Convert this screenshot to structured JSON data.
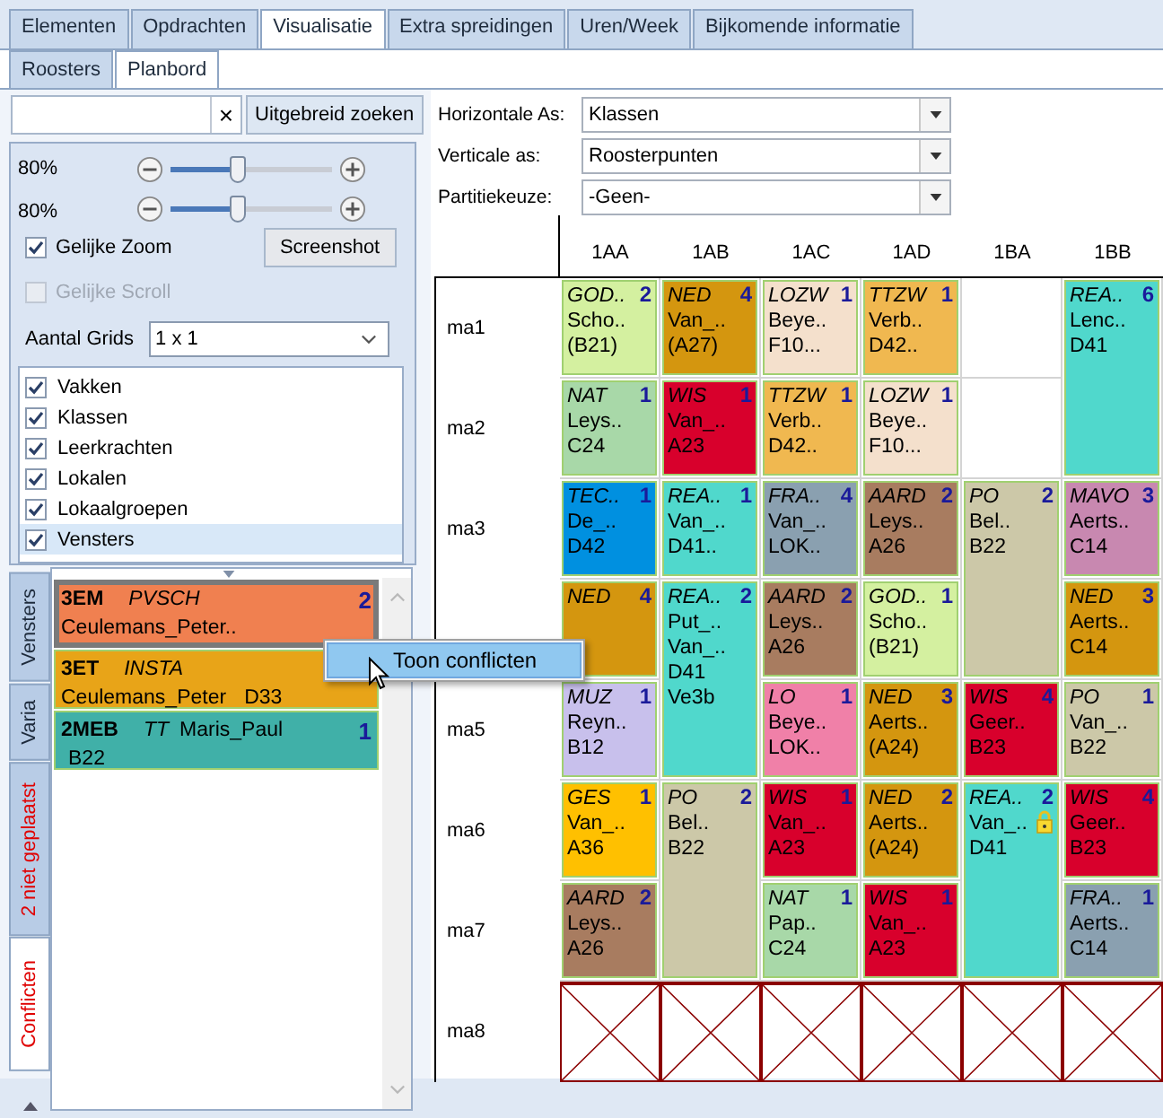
{
  "tabs": [
    {
      "label": "Elementen",
      "selected": false
    },
    {
      "label": "Opdrachten",
      "selected": false
    },
    {
      "label": "Visualisatie",
      "selected": true
    },
    {
      "label": "Extra spreidingen",
      "selected": false
    },
    {
      "label": "Uren/Week",
      "selected": false
    },
    {
      "label": "Bijkomende informatie",
      "selected": false
    }
  ],
  "subtabs": [
    {
      "label": "Roosters",
      "selected": false
    },
    {
      "label": "Planbord",
      "selected": true
    }
  ],
  "search": {
    "clear": "×",
    "button": "Uitgebreid zoeken"
  },
  "zoom": [
    {
      "reading": "80%",
      "level": 0.42
    },
    {
      "reading": "80%",
      "level": 0.42
    }
  ],
  "options": [
    {
      "label": "Gelijke Zoom",
      "checked": true,
      "disabled": false
    },
    {
      "label": "Gelijke Scroll",
      "checked": false,
      "disabled": true
    }
  ],
  "screenshot_button": "Screenshot",
  "grids": {
    "label": "Aantal Grids",
    "value": "1 x 1"
  },
  "layers": [
    {
      "label": "Vakken",
      "checked": true,
      "selected": false
    },
    {
      "label": "Klassen",
      "checked": true,
      "selected": false
    },
    {
      "label": "Leerkrachten",
      "checked": true,
      "selected": false
    },
    {
      "label": "Lokalen",
      "checked": true,
      "selected": false
    },
    {
      "label": "Lokaalgroepen",
      "checked": true,
      "selected": false
    },
    {
      "label": "Vensters",
      "checked": true,
      "selected": true
    }
  ],
  "side_tabs": [
    {
      "label": "Vensters",
      "selected": false,
      "alert": false
    },
    {
      "label": "Varia",
      "selected": false,
      "alert": false
    },
    {
      "label": "2 niet geplaatst",
      "selected": false,
      "alert": true
    },
    {
      "label": "Conflicten",
      "selected": true,
      "alert": true
    }
  ],
  "conflicts": [
    {
      "kind": "standard",
      "class": "3EM",
      "subject": "PVSCH",
      "count": "2",
      "teacher": "Ceulemans_Peter..",
      "color": "#f08050",
      "selected": true
    },
    {
      "kind": "standard",
      "class": "3ET",
      "subject": "INSTA",
      "teacher": "Ceulemans_Peter",
      "room": "D33",
      "color": "#e8a418",
      "selected": false
    },
    {
      "kind": "teacher_first",
      "class": "2MEB",
      "subject": "TT",
      "teacher": "Maris_Paul",
      "count": "1",
      "room": "B22",
      "color": "#40b0a8",
      "selected": false
    }
  ],
  "axes": [
    {
      "label": "Horizontale As:",
      "value": "Klassen"
    },
    {
      "label": "Verticale as:",
      "value": "Roosterpunten"
    },
    {
      "label": "Partitiekeuze:",
      "value": "-Geen-"
    }
  ],
  "grid": {
    "rows": [
      {
        "label": "ma1"
      },
      {
        "label": "ma2"
      },
      {
        "label": "ma3"
      },
      {},
      {
        "label": "ma5"
      },
      {
        "label": "ma6"
      },
      {
        "label": "ma7"
      },
      {
        "label": "ma8"
      }
    ],
    "columns": [
      {
        "label": "1AA",
        "slots": [
          {
            "kind": "lesson",
            "subject": "GOD..",
            "count": "2",
            "lines": [
              "Scho..",
              "(B21)"
            ],
            "color": "#d4f0a0",
            "double": false,
            "locked": false
          },
          {
            "kind": "lesson",
            "subject": "NAT",
            "count": "1",
            "lines": [
              "Leys..",
              "C24"
            ],
            "color": "#a8d8a8",
            "double": false,
            "locked": false
          },
          {
            "kind": "lesson",
            "subject": "TEC..",
            "count": "1",
            "lines": [
              "De_..",
              "D42"
            ],
            "color": "#0090e0",
            "double": false,
            "locked": false
          },
          {
            "kind": "lesson",
            "subject": "NED",
            "count": "4",
            "color": "#d4960f",
            "double": false,
            "locked": false
          },
          {
            "kind": "lesson",
            "subject": "MUZ",
            "count": "1",
            "lines": [
              "Reyn..",
              "B12"
            ],
            "color": "#c8c0ec",
            "double": false,
            "locked": false
          },
          {
            "kind": "lesson",
            "subject": "GES",
            "count": "1",
            "lines": [
              "Van_..",
              "A36"
            ],
            "color": "#ffc000",
            "double": false,
            "locked": false
          },
          {
            "kind": "lesson",
            "subject": "AARD",
            "count": "2",
            "lines": [
              "Leys..",
              "A26"
            ],
            "color": "#a87c60",
            "double": false,
            "locked": false
          },
          {
            "kind": "blocked"
          }
        ]
      },
      {
        "label": "1AB",
        "slots": [
          {
            "kind": "lesson",
            "subject": "NED",
            "count": "4",
            "lines": [
              "Van_..",
              "(A27)"
            ],
            "color": "#d4960f",
            "double": false,
            "locked": false
          },
          {
            "kind": "lesson",
            "subject": "WIS",
            "count": "1",
            "lines": [
              "Van_..",
              "A23"
            ],
            "color": "#d8002c",
            "double": false,
            "locked": false
          },
          {
            "kind": "lesson",
            "subject": "REA..",
            "count": "1",
            "lines": [
              "Van_..",
              "D41.."
            ],
            "color": "#50d8cc",
            "double": false,
            "locked": false
          },
          {
            "kind": "lesson",
            "subject": "REA..",
            "count": "2",
            "lines": [
              "Put_..",
              "Van_..",
              "D41",
              "Ve3b"
            ],
            "color": "#50d8cc",
            "double": true,
            "locked": false
          },
          {
            "kind": "lesson",
            "subject": "PO",
            "count": "2",
            "lines": [
              "Bel..",
              "B22"
            ],
            "color": "#ccc8a8",
            "double": true,
            "locked": false
          },
          {
            "kind": "blocked"
          }
        ]
      },
      {
        "label": "1AC",
        "slots": [
          {
            "kind": "lesson",
            "subject": "LOZW",
            "count": "1",
            "lines": [
              "Beye..",
              "F10..."
            ],
            "color": "#f4e0cc",
            "double": false,
            "locked": false
          },
          {
            "kind": "lesson",
            "subject": "TTZW",
            "count": "1",
            "lines": [
              "Verb..",
              "D42.."
            ],
            "color": "#f0b850",
            "double": false,
            "locked": false
          },
          {
            "kind": "lesson",
            "subject": "FRA..",
            "count": "4",
            "lines": [
              "Van_..",
              "LOK.."
            ],
            "color": "#8aa0b0",
            "double": false,
            "locked": false
          },
          {
            "kind": "lesson",
            "subject": "AARD",
            "count": "2",
            "lines": [
              "Leys..",
              "A26"
            ],
            "color": "#a87c60",
            "double": false,
            "locked": false
          },
          {
            "kind": "lesson",
            "subject": "LO",
            "count": "1",
            "lines": [
              "Beye..",
              "LOK.."
            ],
            "color": "#f080a8",
            "double": false,
            "locked": false
          },
          {
            "kind": "lesson",
            "subject": "WIS",
            "count": "1",
            "lines": [
              "Van_..",
              "A23"
            ],
            "color": "#d8002c",
            "double": false,
            "locked": false
          },
          {
            "kind": "lesson",
            "subject": "NAT",
            "count": "1",
            "lines": [
              "Pap..",
              "C24"
            ],
            "color": "#a8d8a8",
            "double": false,
            "locked": false
          },
          {
            "kind": "blocked"
          }
        ]
      },
      {
        "label": "1AD",
        "slots": [
          {
            "kind": "lesson",
            "subject": "TTZW",
            "count": "1",
            "lines": [
              "Verb..",
              "D42.."
            ],
            "color": "#f0b850",
            "double": false,
            "locked": false
          },
          {
            "kind": "lesson",
            "subject": "LOZW",
            "count": "1",
            "lines": [
              "Beye..",
              "F10..."
            ],
            "color": "#f4e0cc",
            "double": false,
            "locked": false
          },
          {
            "kind": "lesson",
            "subject": "AARD",
            "count": "2",
            "lines": [
              "Leys..",
              "A26"
            ],
            "color": "#a87c60",
            "double": false,
            "locked": false
          },
          {
            "kind": "lesson",
            "subject": "GOD..",
            "count": "1",
            "lines": [
              "Scho..",
              "(B21)"
            ],
            "color": "#d4f0a0",
            "double": false,
            "locked": false
          },
          {
            "kind": "lesson",
            "subject": "NED",
            "count": "3",
            "lines": [
              "Aerts..",
              "(A24)"
            ],
            "color": "#d4960f",
            "double": false,
            "locked": false
          },
          {
            "kind": "lesson",
            "subject": "NED",
            "count": "2",
            "lines": [
              "Aerts..",
              "(A24)"
            ],
            "color": "#d4960f",
            "double": false,
            "locked": false
          },
          {
            "kind": "lesson",
            "subject": "WIS",
            "count": "1",
            "lines": [
              "Van_..",
              "A23"
            ],
            "color": "#d8002c",
            "double": false,
            "locked": false
          },
          {
            "kind": "blocked"
          }
        ]
      },
      {
        "label": "1BA",
        "slots": [
          {
            "kind": "empty"
          },
          {
            "kind": "empty"
          },
          {
            "kind": "lesson",
            "subject": "PO",
            "count": "2",
            "lines": [
              "Bel..",
              "B22"
            ],
            "color": "#ccc8a8",
            "double": true,
            "locked": false
          },
          {
            "kind": "lesson",
            "subject": "WIS",
            "count": "4",
            "lines": [
              "Geer..",
              "B23"
            ],
            "color": "#d8002c",
            "double": false,
            "locked": false
          },
          {
            "kind": "lesson",
            "subject": "REA..",
            "count": "2",
            "lines": [
              "Van_..",
              "D41"
            ],
            "color": "#50d8cc",
            "double": true,
            "locked": true
          },
          {
            "kind": "blocked"
          }
        ]
      },
      {
        "label": "1BB",
        "slots": [
          {
            "kind": "lesson",
            "subject": "REA..",
            "count": "6",
            "lines": [
              "Lenc..",
              "D41"
            ],
            "color": "#50d8cc",
            "double": true,
            "locked": false
          },
          {
            "kind": "lesson",
            "subject": "MAVO",
            "count": "3",
            "lines": [
              "Aerts..",
              "C14"
            ],
            "color": "#c888b0",
            "double": false,
            "locked": false
          },
          {
            "kind": "lesson",
            "subject": "NED",
            "count": "3",
            "lines": [
              "Aerts..",
              "C14"
            ],
            "color": "#d4960f",
            "double": false,
            "locked": false
          },
          {
            "kind": "lesson",
            "subject": "PO",
            "count": "1",
            "lines": [
              "Van_..",
              "B22"
            ],
            "color": "#ccc8a8",
            "double": false,
            "locked": false
          },
          {
            "kind": "lesson",
            "subject": "WIS",
            "count": "4",
            "lines": [
              "Geer..",
              "B23"
            ],
            "color": "#d8002c",
            "double": false,
            "locked": false
          },
          {
            "kind": "lesson",
            "subject": "FRA..",
            "count": "1",
            "lines": [
              "Aerts..",
              "C14"
            ],
            "color": "#8aa0b0",
            "double": false,
            "locked": false
          },
          {
            "kind": "blocked"
          }
        ]
      }
    ]
  },
  "context_menu": {
    "item": "Toon conflicten"
  }
}
